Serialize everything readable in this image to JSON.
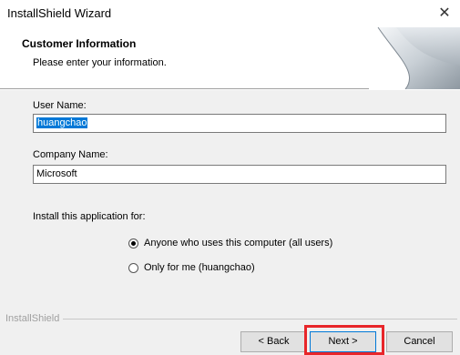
{
  "window": {
    "title": "InstallShield Wizard",
    "close_glyph": "✕"
  },
  "header": {
    "title": "Customer Information",
    "subtitle": "Please enter your information."
  },
  "form": {
    "user_name_label": "User Name:",
    "user_name_value": "huangchao",
    "company_name_label": "Company Name:",
    "company_name_value": "Microsoft",
    "install_for_label": "Install this application for:",
    "options": [
      {
        "label": "Anyone who uses this computer (all users)",
        "selected": true
      },
      {
        "label": "Only for me (huangchao)",
        "selected": false
      }
    ]
  },
  "footer": {
    "brand": "InstallShield",
    "back_label": "< Back",
    "next_label": "Next >",
    "cancel_label": "Cancel"
  },
  "colors": {
    "highlight": "#e8262a",
    "selection": "#0078d7"
  }
}
